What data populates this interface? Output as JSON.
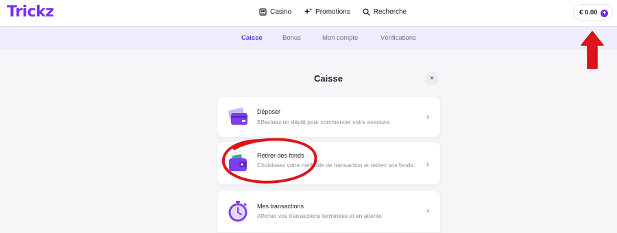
{
  "header": {
    "logo": "Trickz",
    "nav": [
      {
        "label": "Casino",
        "icon": "casino-icon"
      },
      {
        "label": "Promotions",
        "icon": "sparkle-icon"
      },
      {
        "label": "Recherche",
        "icon": "search-icon"
      }
    ],
    "balance": "€ 0.00",
    "balance_plus": "+"
  },
  "subnav": {
    "tabs": [
      "Caisse",
      "Bonus",
      "Mon compte",
      "Vérifications"
    ],
    "active": "Caisse"
  },
  "main": {
    "title": "Caisse",
    "close_label": "×",
    "cards": [
      {
        "title": "Déposer",
        "description": "Effectuez un dépôt pour commencer votre aventure",
        "icon": "credit-card-icon"
      },
      {
        "title": "Retirer des fonds",
        "description": "Choisissez votre méthode de transaction et retirez vos fonds",
        "icon": "wallet-icon"
      },
      {
        "title": "Mes transactions",
        "description": "Afficher vos transactions terminées et en attente",
        "icon": "stopwatch-icon"
      }
    ],
    "chevron": "›"
  },
  "colors": {
    "brand": "#7b2ff0",
    "accent": "#6a2ee8",
    "annotation": "#e0121c",
    "subnav_bg": "#eeedfb"
  }
}
